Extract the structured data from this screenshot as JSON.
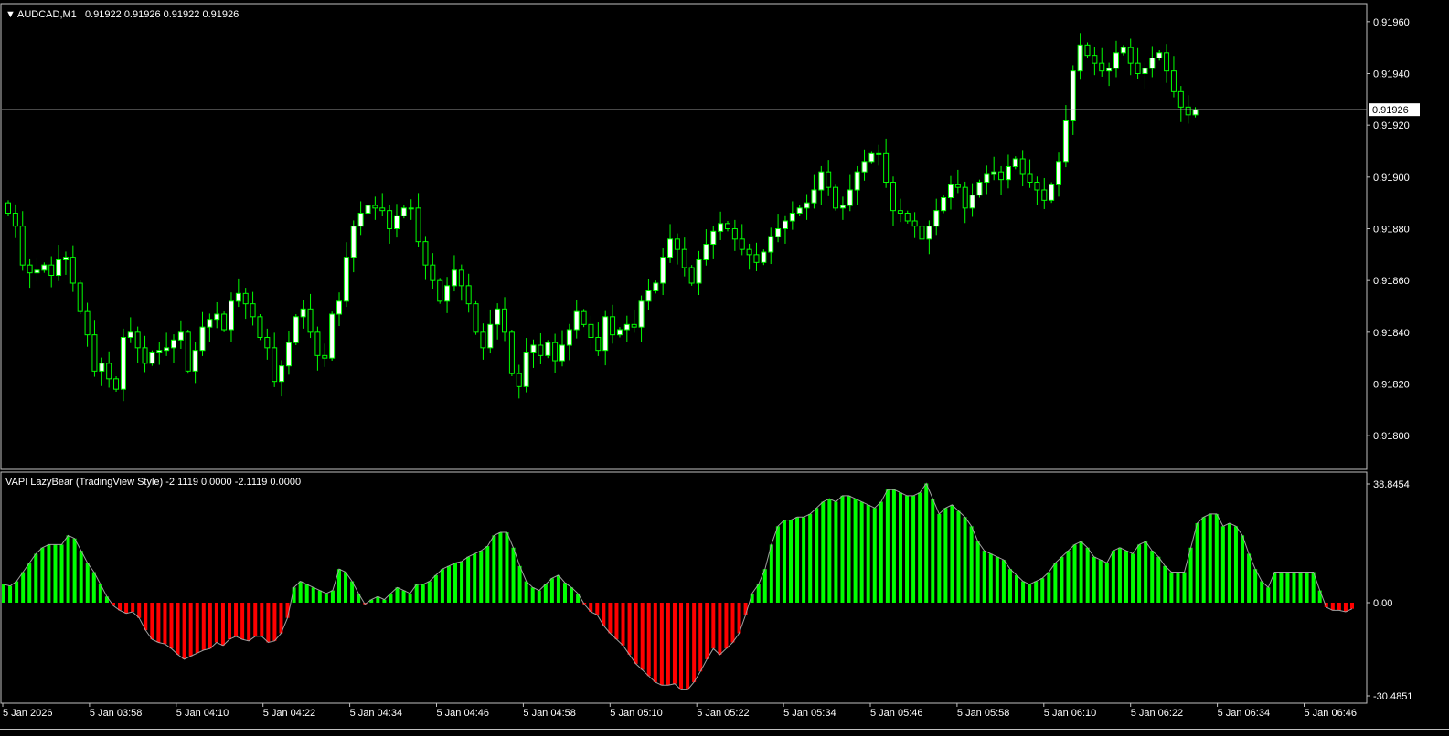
{
  "main_chart": {
    "header_arrow": "▼",
    "symbol": "AUDCAD,M1",
    "ohlc": "0.91922 0.91926 0.91922 0.91926",
    "price_label": "0.91926"
  },
  "indicator": {
    "title": "VAPI LazyBear (TradingView Style) -2.1119 0.0000 -2.1119 0.0000"
  },
  "colors": {
    "background": "#000000",
    "frame": "#c0c0c0",
    "text": "#ffffff",
    "bull_candle_fill": "#ffffff",
    "candle_wick": "#00ff00",
    "positive_histogram": "#00ff00",
    "negative_histogram": "#ff0000",
    "indicator_line": "#a0a0a0",
    "price_line": "#c0c0c0"
  },
  "chart_data": [
    {
      "type": "candlestick",
      "symbol": "AUDCAD",
      "timeframe": "M1",
      "y_ticks": [
        "0.91960",
        "0.91940",
        "0.91920",
        "0.91900",
        "0.91880",
        "0.91860",
        "0.91840",
        "0.91820",
        "0.91800"
      ],
      "ylim": [
        0.91787,
        0.91967
      ],
      "current_price": 0.91926,
      "x_ticks": [
        "5 Jan 2026",
        "5 Jan 03:58",
        "5 Jan 04:10",
        "5 Jan 04:22",
        "5 Jan 04:34",
        "5 Jan 04:46",
        "5 Jan 04:58",
        "5 Jan 05:10",
        "5 Jan 05:22",
        "5 Jan 05:34",
        "5 Jan 05:46",
        "5 Jan 05:58",
        "5 Jan 06:10",
        "5 Jan 06:22",
        "5 Jan 06:34",
        "5 Jan 06:46"
      ],
      "close": [
        0.91886,
        0.91881,
        0.91866,
        0.91863,
        0.91864,
        0.91866,
        0.91862,
        0.91868,
        0.91869,
        0.91859,
        0.91848,
        0.91839,
        0.91825,
        0.91828,
        0.91822,
        0.91818,
        0.91838,
        0.9184,
        0.91834,
        0.91828,
        0.91832,
        0.91833,
        0.91834,
        0.91837,
        0.9184,
        0.91825,
        0.91833,
        0.91842,
        0.91845,
        0.91847,
        0.91841,
        0.91852,
        0.91855,
        0.91851,
        0.91846,
        0.91838,
        0.91834,
        0.91821,
        0.91827,
        0.91836,
        0.91846,
        0.91849,
        0.9184,
        0.91831,
        0.9183,
        0.91847,
        0.91852,
        0.91869,
        0.91881,
        0.91886,
        0.91889,
        0.91888,
        0.91887,
        0.9188,
        0.91885,
        0.91888,
        0.91888,
        0.91875,
        0.91866,
        0.9186,
        0.91852,
        0.91858,
        0.91864,
        0.91858,
        0.91851,
        0.9184,
        0.91834,
        0.91843,
        0.91849,
        0.9184,
        0.91824,
        0.91819,
        0.91832,
        0.91835,
        0.91831,
        0.91836,
        0.91829,
        0.91835,
        0.91841,
        0.91848,
        0.91843,
        0.91838,
        0.91833,
        0.91846,
        0.91839,
        0.91841,
        0.91843,
        0.91842,
        0.91852,
        0.91856,
        0.91859,
        0.91869,
        0.91876,
        0.91872,
        0.91865,
        0.91859,
        0.91868,
        0.91874,
        0.91879,
        0.91882,
        0.9188,
        0.91876,
        0.91872,
        0.9187,
        0.91867,
        0.91871,
        0.91877,
        0.9188,
        0.91883,
        0.91886,
        0.91888,
        0.9189,
        0.91895,
        0.91902,
        0.91896,
        0.91888,
        0.91889,
        0.91895,
        0.91902,
        0.91906,
        0.91909,
        0.91909,
        0.91898,
        0.91887,
        0.91886,
        0.91883,
        0.91881,
        0.91876,
        0.91881,
        0.91887,
        0.91892,
        0.91897,
        0.91896,
        0.91888,
        0.91893,
        0.91898,
        0.91901,
        0.91902,
        0.91899,
        0.91904,
        0.91907,
        0.91901,
        0.91898,
        0.91895,
        0.91891,
        0.91897,
        0.91906,
        0.91922,
        0.91941,
        0.91951,
        0.91947,
        0.91944,
        0.91941,
        0.91942,
        0.91948,
        0.9195,
        0.91944,
        0.9194,
        0.91942,
        0.91946,
        0.91948,
        0.91941,
        0.91933,
        0.91927,
        0.91924,
        0.91926
      ]
    },
    {
      "type": "bar",
      "name": "VAPI LazyBear (TradingView Style)",
      "y_ticks": [
        "38.8454",
        "0.00",
        "-30.4851"
      ],
      "ylim": [
        -30.4851,
        38.8454
      ],
      "last_values": [
        -2.1119,
        0.0,
        -2.1119,
        0.0
      ],
      "values": [
        6,
        5.5,
        7,
        10,
        13,
        16,
        18,
        19,
        19,
        19,
        22,
        21,
        17,
        13,
        10,
        6,
        2,
        -1,
        -2.5,
        -3.5,
        -3,
        -5,
        -9,
        -12,
        -13,
        -13.5,
        -15,
        -17,
        -18.5,
        -17.5,
        -16.5,
        -15.5,
        -15,
        -13,
        -14,
        -12,
        -11,
        -12,
        -12.5,
        -11,
        -11,
        -13,
        -12.5,
        -10,
        -5,
        5,
        7,
        6,
        5,
        4,
        3,
        4,
        11,
        10,
        7,
        3,
        -0.5,
        1,
        2,
        1,
        3,
        5,
        4,
        3,
        6,
        6,
        7,
        9,
        11,
        12,
        13,
        13.5,
        15,
        16,
        17,
        18.5,
        22,
        23,
        23,
        18,
        12,
        7,
        5,
        4,
        6,
        8,
        9,
        6.5,
        5,
        3,
        -0.5,
        -3,
        -4,
        -7.5,
        -10,
        -12,
        -14,
        -17,
        -20,
        -22,
        -24,
        -26,
        -27,
        -27,
        -26.5,
        -28.5,
        -28.5,
        -26,
        -22.5,
        -18.5,
        -15,
        -17,
        -15,
        -13,
        -10,
        -4,
        3,
        6,
        11,
        19,
        25,
        27,
        27,
        28,
        28,
        29,
        31,
        33,
        34,
        33,
        35,
        35,
        34,
        33,
        32,
        31,
        33,
        37,
        37,
        36,
        35,
        35,
        36,
        39,
        34,
        29,
        31,
        32,
        30,
        28,
        25,
        20,
        17,
        16,
        15,
        14,
        11,
        9,
        7,
        6,
        7,
        8,
        10,
        13,
        15,
        17,
        19,
        20,
        18,
        15,
        14,
        13,
        17,
        18,
        17,
        16,
        19,
        20,
        17,
        15,
        12,
        10,
        10,
        10,
        18,
        26,
        28,
        29,
        29,
        25,
        26,
        25,
        22,
        16,
        11,
        7,
        5,
        10,
        10,
        10,
        10,
        10,
        10,
        10,
        4,
        -1.5,
        -2.5,
        -2.5,
        -3,
        -2
      ]
    }
  ]
}
